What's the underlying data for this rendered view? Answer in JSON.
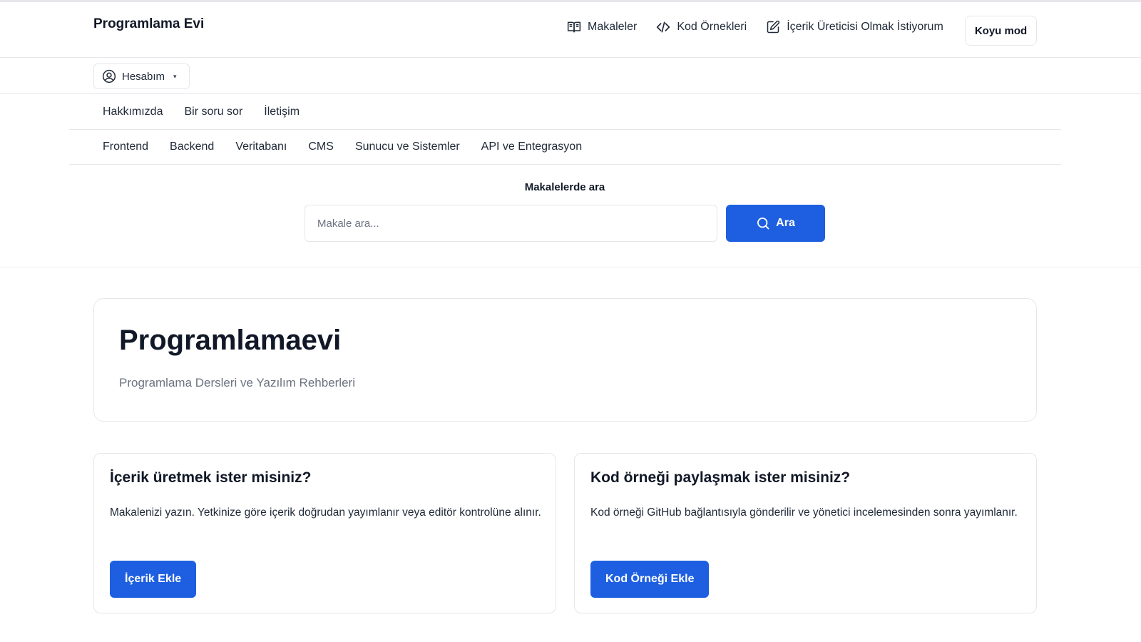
{
  "brand": {
    "name": "Programlama Evi"
  },
  "topnav": {
    "items": [
      {
        "label": "Makaleler",
        "icon": "book-open-icon"
      },
      {
        "label": "Kod Örnekleri",
        "icon": "code-icon"
      },
      {
        "label": "İçerik Üreticisi Olmak İstiyorum",
        "icon": "edit-icon"
      }
    ],
    "darkmode_label": "Koyu mod"
  },
  "account": {
    "label": "Hesabım",
    "icon": "user-circle-icon",
    "caret": "▾"
  },
  "infonav": {
    "items": [
      "Hakkımızda",
      "Bir soru sor",
      "İletişim"
    ]
  },
  "catnav": {
    "items": [
      "Frontend",
      "Backend",
      "Veritabanı",
      "CMS",
      "Sunucu ve Sistemler",
      "API ve Entegrasyon"
    ]
  },
  "search": {
    "title": "Makalelerde ara",
    "placeholder": "Makale ara...",
    "value": "",
    "button_label": "Ara",
    "icon": "search-icon"
  },
  "hero": {
    "title": "Programlamaevi",
    "subtitle": "Programlama Dersleri ve Yazılım Rehberleri"
  },
  "cards": [
    {
      "title": "İçerik üretmek ister misiniz?",
      "text": "Makalenizi yazın. Yetkinize göre içerik doğrudan yayımlanır veya editör kontrolüne alınır.",
      "button_label": "İçerik Ekle"
    },
    {
      "title": "Kod örneği paylaşmak ister misiniz?",
      "text": "Kod örneği GitHub bağlantısıyla gönderilir ve yönetici incelemesinden sonra yayımlanır.",
      "button_label": "Kod Örneği Ekle"
    }
  ],
  "colors": {
    "accent": "#1d5fe0",
    "border": "#e5e7eb",
    "muted_text": "#6b7280"
  }
}
